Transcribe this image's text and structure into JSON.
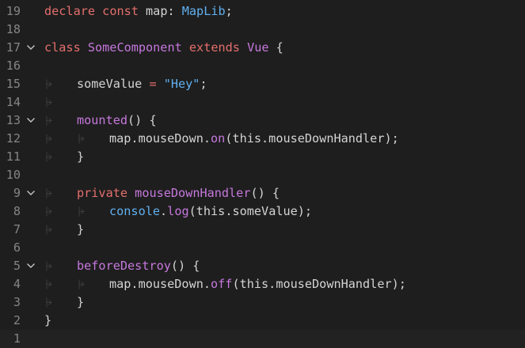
{
  "editor": {
    "theme": {
      "background": "#1e1e1e",
      "line_number": "#858585",
      "default": "#d4d4d4",
      "keyword": "#e46f6c",
      "type": "#61afef",
      "function": "#c678dd",
      "string": "#98c379",
      "guide": "#3c3c3c"
    },
    "lines": [
      {
        "number": "19",
        "fold": false,
        "indent": 0,
        "tokens": [
          {
            "text": "declare",
            "kind": "keyword"
          },
          {
            "text": " ",
            "kind": "default"
          },
          {
            "text": "const",
            "kind": "keyword"
          },
          {
            "text": " map: ",
            "kind": "default"
          },
          {
            "text": "MapLib",
            "kind": "type"
          },
          {
            "text": ";",
            "kind": "default"
          }
        ]
      },
      {
        "number": "18",
        "fold": false,
        "indent": 0,
        "tokens": []
      },
      {
        "number": "17",
        "fold": true,
        "indent": 0,
        "tokens": [
          {
            "text": "class",
            "kind": "keyword"
          },
          {
            "text": " ",
            "kind": "default"
          },
          {
            "text": "SomeComponent",
            "kind": "function"
          },
          {
            "text": " ",
            "kind": "default"
          },
          {
            "text": "extends",
            "kind": "keyword"
          },
          {
            "text": " ",
            "kind": "default"
          },
          {
            "text": "Vue",
            "kind": "function"
          },
          {
            "text": " {",
            "kind": "default"
          }
        ]
      },
      {
        "number": "16",
        "fold": false,
        "indent": 0,
        "tokens": []
      },
      {
        "number": "15",
        "fold": false,
        "indent": 1,
        "tokens": [
          {
            "text": "someValue",
            "kind": "default"
          },
          {
            "text": " = ",
            "kind": "keyword"
          },
          {
            "text": "\"Hey\"",
            "kind": "type"
          },
          {
            "text": ";",
            "kind": "default"
          }
        ]
      },
      {
        "number": "14",
        "fold": false,
        "indent": 1,
        "tokens": []
      },
      {
        "number": "13",
        "fold": true,
        "indent": 1,
        "tokens": [
          {
            "text": "mounted",
            "kind": "function"
          },
          {
            "text": "() {",
            "kind": "default"
          }
        ]
      },
      {
        "number": "12",
        "fold": false,
        "indent": 2,
        "tokens": [
          {
            "text": "map.mouseDown.",
            "kind": "default"
          },
          {
            "text": "on",
            "kind": "function"
          },
          {
            "text": "(this.mouseDownHandler);",
            "kind": "default"
          }
        ]
      },
      {
        "number": "11",
        "fold": false,
        "indent": 1,
        "tokens": [
          {
            "text": "}",
            "kind": "default"
          }
        ]
      },
      {
        "number": "10",
        "fold": false,
        "indent": 0,
        "tokens": []
      },
      {
        "number": "9",
        "fold": true,
        "indent": 1,
        "tokens": [
          {
            "text": "private",
            "kind": "keyword"
          },
          {
            "text": " ",
            "kind": "default"
          },
          {
            "text": "mouseDownHandler",
            "kind": "function"
          },
          {
            "text": "() {",
            "kind": "default"
          }
        ]
      },
      {
        "number": "8",
        "fold": false,
        "indent": 2,
        "tokens": [
          {
            "text": "console",
            "kind": "type"
          },
          {
            "text": ".",
            "kind": "default"
          },
          {
            "text": "log",
            "kind": "function"
          },
          {
            "text": "(this.someValue);",
            "kind": "default"
          }
        ]
      },
      {
        "number": "7",
        "fold": false,
        "indent": 1,
        "tokens": [
          {
            "text": "}",
            "kind": "default"
          }
        ]
      },
      {
        "number": "6",
        "fold": false,
        "indent": 0,
        "tokens": []
      },
      {
        "number": "5",
        "fold": true,
        "indent": 1,
        "tokens": [
          {
            "text": "beforeDestroy",
            "kind": "function"
          },
          {
            "text": "() {",
            "kind": "default"
          }
        ]
      },
      {
        "number": "4",
        "fold": false,
        "indent": 2,
        "tokens": [
          {
            "text": "map.mouseDown.",
            "kind": "default"
          },
          {
            "text": "off",
            "kind": "function"
          },
          {
            "text": "(this.mouseDownHandler);",
            "kind": "default"
          }
        ]
      },
      {
        "number": "3",
        "fold": false,
        "indent": 1,
        "tokens": [
          {
            "text": "}",
            "kind": "default"
          }
        ]
      },
      {
        "number": "2",
        "fold": false,
        "indent": 0,
        "tokens": [
          {
            "text": "}",
            "kind": "default"
          }
        ]
      },
      {
        "number": "1",
        "fold": false,
        "indent": 0,
        "tokens": [],
        "current": true
      }
    ]
  }
}
